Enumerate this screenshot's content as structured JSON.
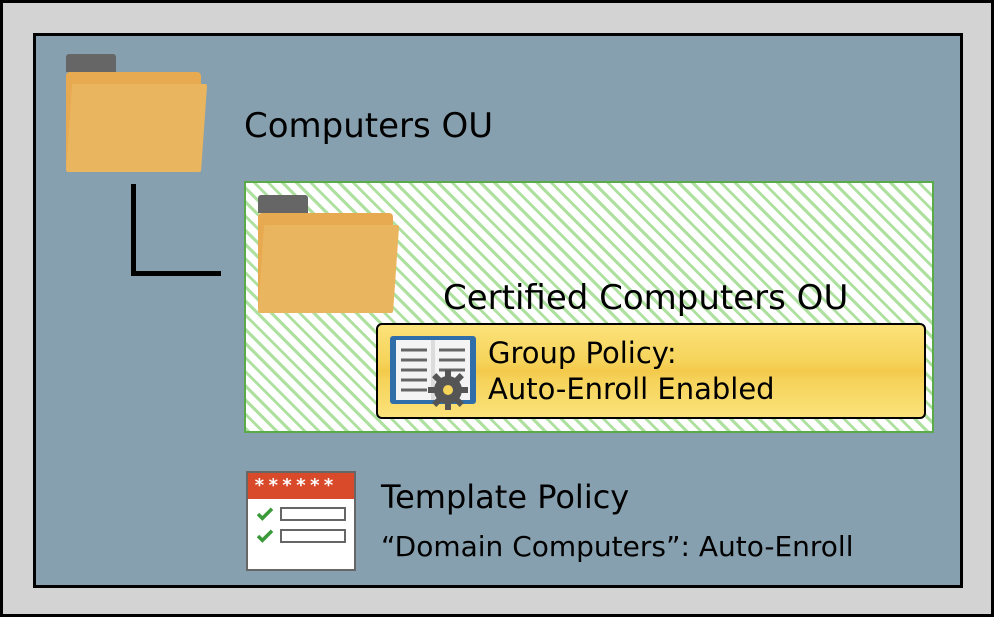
{
  "parent_ou": {
    "label": "Computers OU"
  },
  "child_ou": {
    "label": "Certified Computers OU",
    "policy": {
      "line1": "Group Policy:",
      "line2": "Auto-Enroll Enabled"
    }
  },
  "template": {
    "header_text": "******",
    "title": "Template Policy",
    "subtitle": "“Domain Computers”: Auto-Enroll"
  }
}
